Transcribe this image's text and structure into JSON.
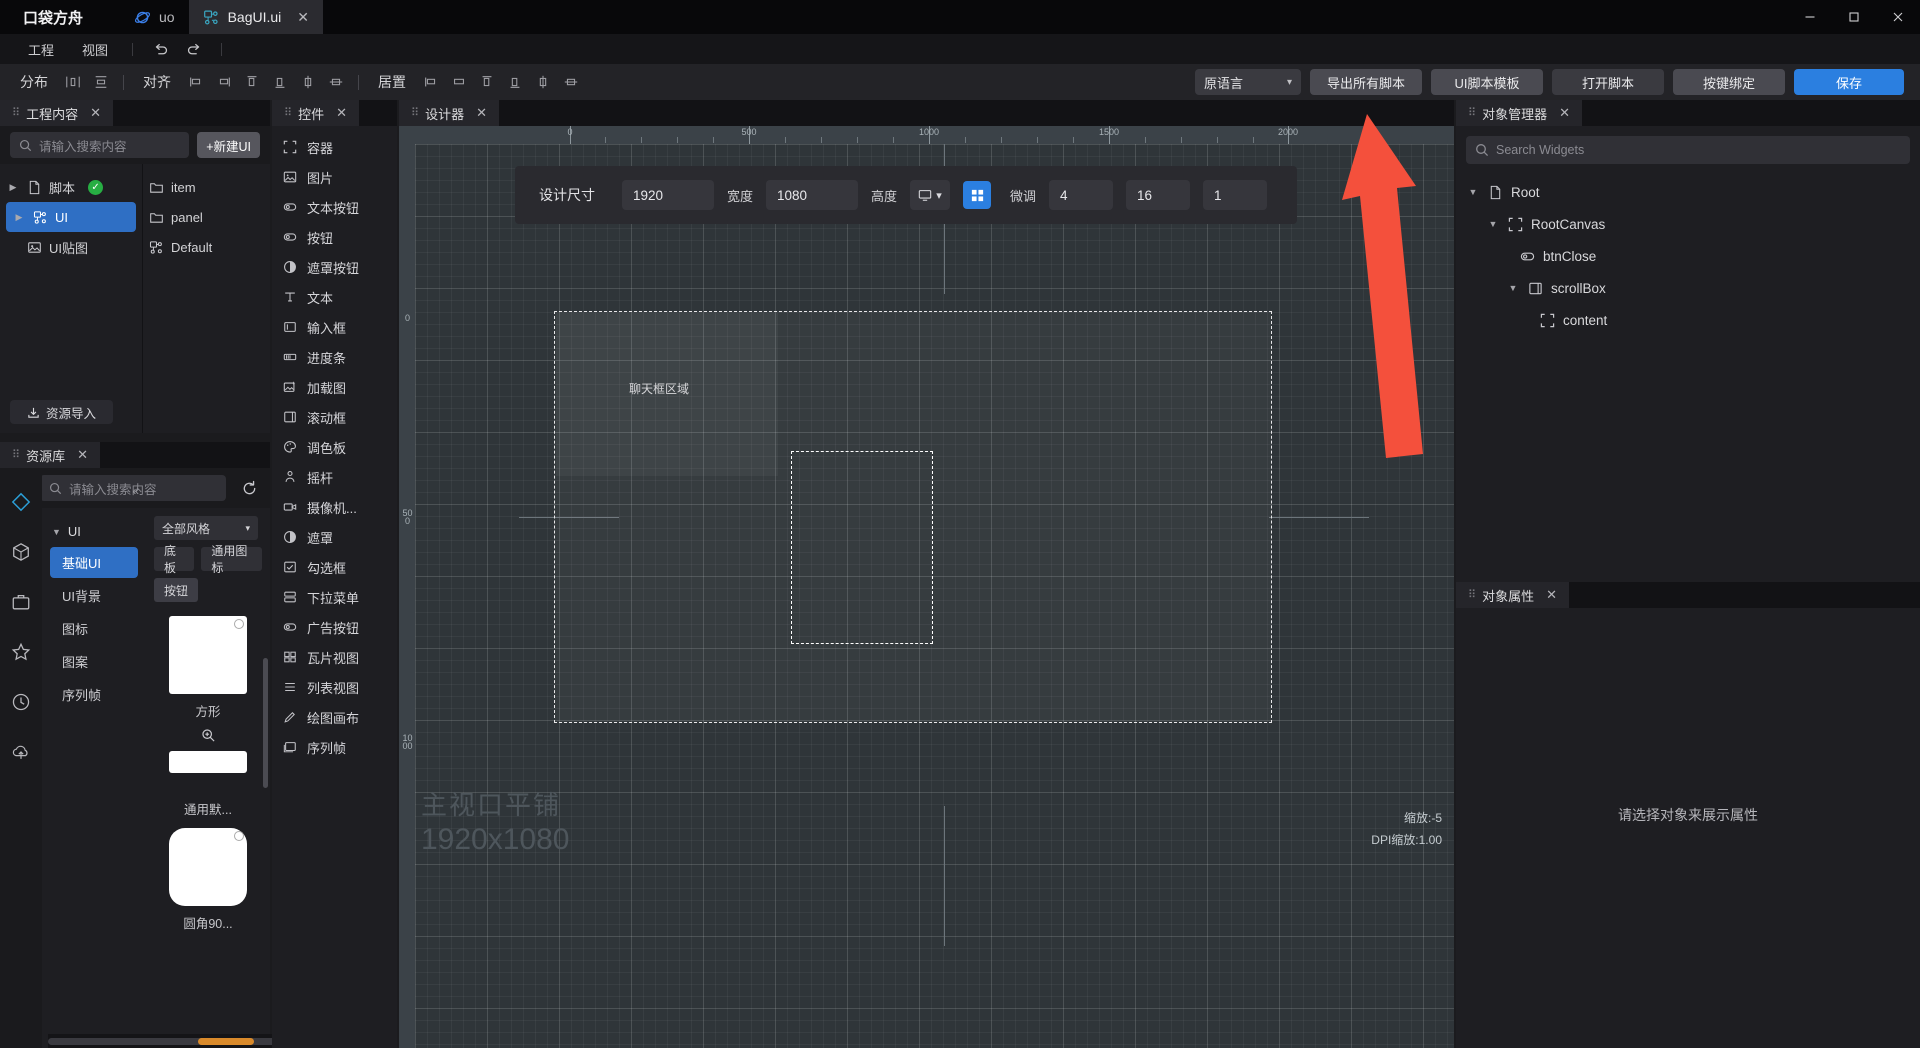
{
  "app": {
    "brand": "口袋方舟",
    "tabs": [
      {
        "label": "uo",
        "icon": "planet-icon",
        "active": false,
        "closable": false
      },
      {
        "label": "BagUI.ui",
        "icon": "ui-node-icon",
        "active": true,
        "closable": true
      }
    ],
    "window_controls": [
      "minimize",
      "maximize",
      "close"
    ]
  },
  "menubar": {
    "items": [
      {
        "label": "工程"
      },
      {
        "label": "视图"
      }
    ],
    "undo_icon": "undo-icon",
    "redo_icon": "redo-icon"
  },
  "toolbar": {
    "distribute_label": "分布",
    "align_label": "对齐",
    "center_label": "居置",
    "language_select": "原语言",
    "export_all_scripts": "导出所有脚本",
    "ui_script_template": "UI脚本模板",
    "open_script": "打开脚本",
    "key_binding": "按键绑定",
    "save": "保存"
  },
  "project_panel": {
    "tab_title": "工程内容",
    "search_placeholder": "请输入搜索内容",
    "new_ui_button": "+新建UI",
    "import_button": "资源导入",
    "tree": [
      {
        "label": "脚本",
        "icon": "file-icon",
        "expandable": true,
        "selected": false,
        "status": "ok"
      },
      {
        "label": "UI",
        "icon": "ui-node-icon",
        "expandable": true,
        "selected": true
      },
      {
        "label": "UI贴图",
        "icon": "image-icon",
        "expandable": false,
        "selected": false
      }
    ],
    "files": [
      {
        "label": "item",
        "icon": "folder-icon"
      },
      {
        "label": "panel",
        "icon": "folder-icon"
      },
      {
        "label": "Default",
        "icon": "ui-node-icon"
      }
    ]
  },
  "resource_panel": {
    "tab_title": "资源库",
    "search_placeholder": "请输入搜索内容",
    "refresh_icon": "refresh-icon",
    "style_select": "全部风格",
    "chips": [
      {
        "label": "底板",
        "selected": false
      },
      {
        "label": "通用图标",
        "selected": false
      },
      {
        "label": "按钮",
        "selected": true
      }
    ],
    "group_label": "UI",
    "categories": [
      {
        "label": "基础UI",
        "selected": true
      },
      {
        "label": "UI背景",
        "selected": false
      },
      {
        "label": "图标",
        "selected": false
      },
      {
        "label": "图案",
        "selected": false
      },
      {
        "label": "序列帧",
        "selected": false
      }
    ],
    "items": [
      {
        "caption": "方形"
      },
      {
        "caption": "通用默..."
      },
      {
        "caption": "圆角90..."
      }
    ],
    "rail_icons": [
      "diamond-icon",
      "cube-icon",
      "briefcase-icon",
      "star-icon",
      "clock-icon",
      "upload-cloud-icon"
    ]
  },
  "widgets_panel": {
    "tab_title": "控件",
    "items": [
      {
        "label": "容器",
        "icon": "container-icon"
      },
      {
        "label": "图片",
        "icon": "image-icon"
      },
      {
        "label": "文本按钮",
        "icon": "text-button-icon"
      },
      {
        "label": "按钮",
        "icon": "button-icon"
      },
      {
        "label": "遮罩按钮",
        "icon": "mask-button-icon"
      },
      {
        "label": "文本",
        "icon": "text-icon"
      },
      {
        "label": "输入框",
        "icon": "input-icon"
      },
      {
        "label": "进度条",
        "icon": "progress-icon"
      },
      {
        "label": "加载图",
        "icon": "loading-image-icon"
      },
      {
        "label": "滚动框",
        "icon": "scrollbox-icon"
      },
      {
        "label": "调色板",
        "icon": "palette-icon"
      },
      {
        "label": "摇杆",
        "icon": "joystick-icon"
      },
      {
        "label": "摄像机...",
        "icon": "camera-icon"
      },
      {
        "label": "遮罩",
        "icon": "mask-icon"
      },
      {
        "label": "勾选框",
        "icon": "checkbox-icon"
      },
      {
        "label": "下拉菜单",
        "icon": "dropdown-icon"
      },
      {
        "label": "广告按钮",
        "icon": "ad-button-icon"
      },
      {
        "label": "瓦片视图",
        "icon": "tile-view-icon"
      },
      {
        "label": "列表视图",
        "icon": "list-view-icon"
      },
      {
        "label": "绘图画布",
        "icon": "canvas-icon"
      },
      {
        "label": "序列帧",
        "icon": "sequence-icon"
      }
    ]
  },
  "designer": {
    "tab_title": "设计器",
    "size_bar": {
      "title": "设计尺寸",
      "width_value": "1920",
      "width_label": "宽度",
      "height_value": "1080",
      "height_label": "高度",
      "device_icon": "monitor-icon",
      "grid_toggle_icon": "grid-icon",
      "fine_tune_label": "微调",
      "fine_1": "4",
      "fine_2": "16",
      "fine_3": "1"
    },
    "ruler_labels_h": [
      "0",
      "500",
      "1000",
      "1500",
      "2000"
    ],
    "ruler_labels_v": [
      "0",
      "500",
      "1000"
    ],
    "chat_area_label": "聊天框区域",
    "viewport_text": "主视口平铺",
    "viewport_size": "1920x1080",
    "zoom_text": "缩放:-5",
    "dpi_text": "DPI缩放:1.00",
    "corner_value": "1080"
  },
  "object_manager": {
    "tab_title": "对象管理器",
    "search_placeholder": "Search Widgets",
    "tree": [
      {
        "label": "Root",
        "icon": "file-icon",
        "depth": 0,
        "caret": "down"
      },
      {
        "label": "RootCanvas",
        "icon": "container-icon",
        "depth": 1,
        "caret": "down"
      },
      {
        "label": "btnClose",
        "icon": "button-icon",
        "depth": 2,
        "caret": "none"
      },
      {
        "label": "scrollBox",
        "icon": "scrollbox-icon",
        "depth": 2,
        "caret": "down"
      },
      {
        "label": "content",
        "icon": "container-icon",
        "depth": 3,
        "caret": "none"
      }
    ]
  },
  "object_properties": {
    "tab_title": "对象属性",
    "empty_text": "请选择对象来展示属性"
  },
  "colors": {
    "accent": "#2b7fe0",
    "select": "#2f6fc4",
    "arrow": "#f4503c",
    "ok": "#27ae43",
    "canvas": "#2f3539"
  }
}
